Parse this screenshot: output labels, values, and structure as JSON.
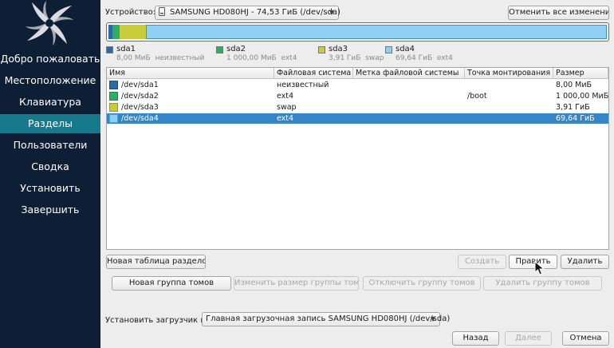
{
  "sidebar": {
    "items": [
      {
        "label": "Добро пожаловать"
      },
      {
        "label": "Местоположение"
      },
      {
        "label": "Клавиатура"
      },
      {
        "label": "Разделы",
        "active": true
      },
      {
        "label": "Пользователи"
      },
      {
        "label": "Сводка"
      },
      {
        "label": "Установить"
      },
      {
        "label": "Завершить"
      }
    ]
  },
  "header": {
    "device_label": "Устройство:",
    "device_value": "SAMSUNG HD080HJ - 74,53 ГиБ (/dev/sda)",
    "revert_button": "Отменить все изменения"
  },
  "partitions": [
    {
      "name": "sda1",
      "size": "8,00 МиБ",
      "fs": "неизвестный",
      "device": "/dev/sda1",
      "mount": "",
      "color": "#2b6aa8",
      "fraction": 0.0001
    },
    {
      "name": "sda2",
      "size": "1 000,00 МиБ",
      "fs": "ext4",
      "device": "/dev/sda2",
      "mount": "/boot",
      "color": "#2cae63",
      "fraction": 0.0131
    },
    {
      "name": "sda3",
      "size": "3,91 ГиБ",
      "fs": "swap",
      "device": "/dev/sda3",
      "mount": "",
      "color": "#c9cc3a",
      "fraction": 0.0525
    },
    {
      "name": "sda4",
      "size": "69,64 ГиБ",
      "fs": "ext4",
      "device": "/dev/sda4",
      "mount": "",
      "color": "#8ecff3",
      "fraction": 0.9343,
      "selected": true
    }
  ],
  "table": {
    "columns": [
      "Имя",
      "Файловая система",
      "Метка файловой системы",
      "Точка монтирования",
      "Размер"
    ]
  },
  "buttons": {
    "new_table": "Новая таблица разделов",
    "create": "Создать",
    "edit": "Править",
    "delete": "Удалить",
    "new_group": "Новая группа томов",
    "resize_group": "Изменить размер группы томов",
    "disable_group": "Отключить группу томов",
    "remove_group": "Удалить группу томов",
    "back": "Назад",
    "next": "Далее",
    "cancel": "Отмена"
  },
  "bootloader": {
    "label": "Установить загрузчик в:",
    "value": "Главная загрузочная запись SAMSUNG HD080HJ (/dev/sda)"
  }
}
